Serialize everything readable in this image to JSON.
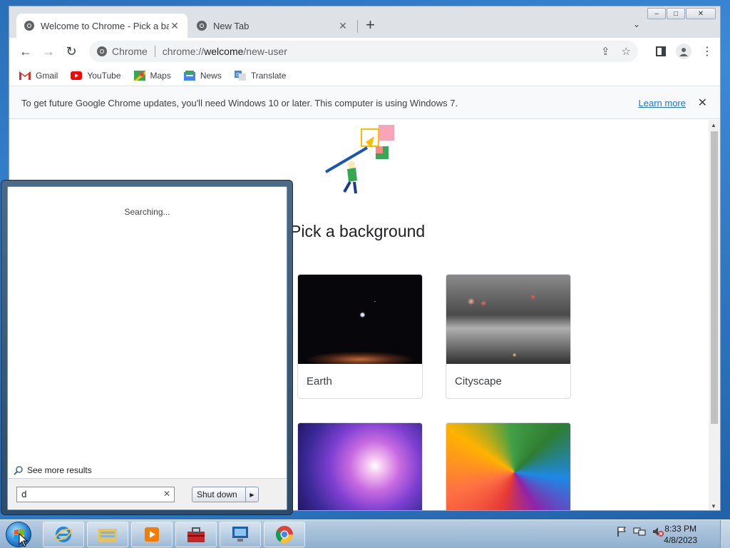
{
  "chrome": {
    "tabs": [
      {
        "title": "Welcome to Chrome - Pick a background",
        "active": true
      },
      {
        "title": "New Tab",
        "active": false
      }
    ],
    "window_controls": {
      "minimize": "–",
      "maximize": "□",
      "close": "✕"
    },
    "omnibox": {
      "site": "Chrome",
      "url_prefix": "chrome://",
      "url_host": "welcome",
      "url_path": "/new-user"
    },
    "bookmarks": [
      {
        "label": "Gmail",
        "icon": "gmail-icon"
      },
      {
        "label": "YouTube",
        "icon": "youtube-icon"
      },
      {
        "label": "Maps",
        "icon": "maps-icon"
      },
      {
        "label": "News",
        "icon": "news-icon"
      },
      {
        "label": "Translate",
        "icon": "translate-icon"
      }
    ],
    "infobar": {
      "message": "To get future Google Chrome updates, you'll need Windows 10 or later. This computer is using Windows 7.",
      "link": "Learn more"
    },
    "page": {
      "title": "Pick a background",
      "backgrounds": [
        {
          "label": "Earth"
        },
        {
          "label": "Cityscape"
        },
        {
          "label": ""
        },
        {
          "label": ""
        }
      ]
    }
  },
  "start_menu": {
    "status": "Searching...",
    "see_more": "See more results",
    "search_value": "d",
    "shutdown_label": "Shut down"
  },
  "taskbar": {
    "time": "8:33 PM",
    "date": "4/8/2023",
    "pinned": [
      "internet-explorer-icon",
      "windows-explorer-icon",
      "media-player-icon",
      "toolbox-icon",
      "remote-desktop-icon",
      "chrome-icon"
    ]
  },
  "colors": {
    "accent": "#1a73e8",
    "taskbar": "#a7c1dc"
  }
}
